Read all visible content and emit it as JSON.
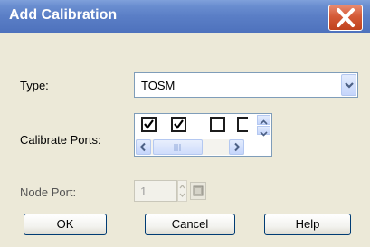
{
  "dialog": {
    "title": "Add Calibration"
  },
  "form": {
    "type_label": "Type:",
    "type_value": "TOSM",
    "calibrate_ports_label": "Calibrate Ports:",
    "ports": [
      {
        "checked": true
      },
      {
        "checked": true
      },
      {
        "checked": false
      },
      {
        "checked": false
      }
    ],
    "node_port_label": "Node Port:",
    "node_port_value": "1"
  },
  "buttons": {
    "ok": "OK",
    "cancel": "Cancel",
    "help": "Help"
  },
  "icons": {
    "close": "close-icon",
    "dropdown": "chevron-down-icon",
    "spin_up": "arrow-up-icon",
    "spin_down": "arrow-down-icon",
    "scroll_left": "arrow-left-icon",
    "scroll_right": "arrow-right-icon",
    "node_picker": "node-picker-icon"
  },
  "colors": {
    "title_bar": "#5a7ec6",
    "close_button": "#d45a37",
    "dialog_background": "#ECE9D8",
    "button_border": "#003c74"
  }
}
